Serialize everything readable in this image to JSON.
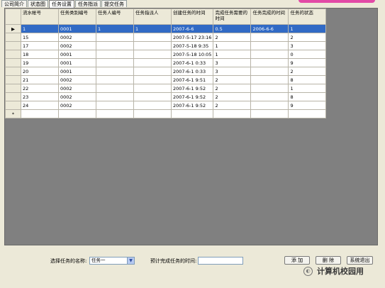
{
  "tabs": [
    "公司简介",
    "状态图",
    "任务设置",
    "任务指派",
    "提交任务"
  ],
  "active_tab": 2,
  "grid": {
    "columns": [
      "流水帐号",
      "任务类别编号",
      "任务人编号",
      "任务指派人",
      "创建任务的时间",
      "完成任务需要的时间",
      "任务完成的时间",
      "任务的状态"
    ],
    "rows": [
      [
        "1",
        "0001",
        "1",
        "1",
        "2007-6-6",
        "0.5",
        "2006-6-6",
        "1"
      ],
      [
        "15",
        "0002",
        "",
        "",
        "2007-5-17 23:16",
        "2",
        "",
        "2"
      ],
      [
        "17",
        "0002",
        "",
        "",
        "2007-5-18 9:35",
        "1",
        "",
        "3"
      ],
      [
        "18",
        "0001",
        "",
        "",
        "2007-5-18 10:05",
        "1",
        "",
        "0"
      ],
      [
        "19",
        "0001",
        "",
        "",
        "2007-6-1 0:33",
        "3",
        "",
        "9"
      ],
      [
        "20",
        "0001",
        "",
        "",
        "2007-6-1 0:33",
        "3",
        "",
        "2"
      ],
      [
        "21",
        "0002",
        "",
        "",
        "2007-6-1 9:51",
        "2",
        "",
        "8"
      ],
      [
        "22",
        "0002",
        "",
        "",
        "2007-6-1 9:52",
        "2",
        "",
        "1"
      ],
      [
        "23",
        "0002",
        "",
        "",
        "2007-6-1 9:52",
        "2",
        "",
        "8"
      ],
      [
        "24",
        "0002",
        "",
        "",
        "2007-6-1 9:52",
        "2",
        "",
        "9"
      ]
    ],
    "selected_row_marker": "▶",
    "new_row_marker": "*"
  },
  "form": {
    "task_name_label": "选择任务的名称:",
    "task_name_value": "任务一",
    "expected_time_label": "预计完成任务的时间:",
    "expected_time_value": ""
  },
  "buttons": {
    "add": "添 加",
    "delete": "删 除",
    "exit": "系统退出"
  },
  "watermark": {
    "text": "计算机校园用"
  },
  "colors": {
    "selection": "#316ac5",
    "grid_bg": "#808080",
    "window_bg": "#ece9d8",
    "accent_pink": "#e24aa6"
  }
}
